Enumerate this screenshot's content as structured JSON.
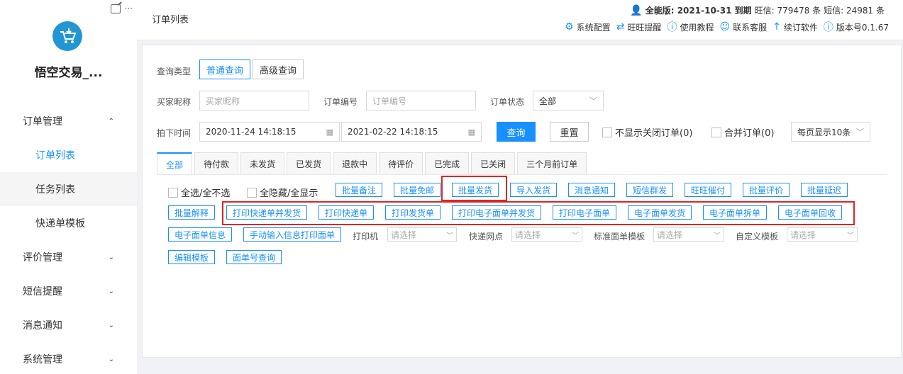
{
  "sidebar": {
    "app_name": "悟空交易_...",
    "menu": [
      {
        "label": "订单管理",
        "chev": "⌃"
      },
      {
        "label": "订单列表"
      },
      {
        "label": "任务列表"
      },
      {
        "label": "快递单模板"
      },
      {
        "label": "评价管理",
        "chev": "⌄"
      },
      {
        "label": "短信提醒",
        "chev": "⌄"
      },
      {
        "label": "消息通知",
        "chev": "⌄"
      },
      {
        "label": "系统管理",
        "chev": "⌄"
      }
    ]
  },
  "header": {
    "title": "订单列表",
    "edition": "全能版: 2021-10-31 到期",
    "wangxin": "旺信: 779478 条",
    "sms": "短信: 24981 条",
    "links": [
      "系统配置",
      "旺旺提醒",
      "使用教程",
      "联系客服",
      "续订软件",
      "版本号0.1.67"
    ]
  },
  "query": {
    "type_label": "查询类型",
    "normal": "普通查询",
    "advanced": "高级查询",
    "buyer_label": "买家昵称",
    "buyer_ph": "买家昵称",
    "order_no_label": "订单编号",
    "order_no_ph": "订单编号",
    "status_label": "订单状态",
    "status_value": "全部",
    "time_label": "拍下时间",
    "start_time": "2020-11-24 14:18:15",
    "end_time": "2021-02-22 14:18:15",
    "search": "查询",
    "reset": "重置",
    "hide_closed": "不显示关闭订单(0)",
    "merge": "合并订单(0)",
    "page_size": "每页显示10条"
  },
  "tabs": [
    "全部",
    "待付款",
    "未发货",
    "已发货",
    "退款中",
    "待评价",
    "已完成",
    "已关闭",
    "三个月前订单"
  ],
  "actions": {
    "select_all": "全选/全不选",
    "hide_all": "全隐藏/全显示",
    "row1": [
      "批量备注",
      "批量免邮",
      "批量发货",
      "导入发货",
      "消息通知",
      "短信群发",
      "旺旺催付",
      "批量评价",
      "批量延迟"
    ],
    "row2": [
      "批量解释",
      "打印快递单并发货",
      "打印快递单",
      "打印发货单",
      "打印电子面单并发货",
      "打印电子面单",
      "电子面单发货",
      "电子面单拆单",
      "电子面单回收"
    ],
    "row3_btns": [
      "电子面单信息",
      "手动输入信息打印面单"
    ],
    "printer_label": "打印机",
    "site_label": "快递网点",
    "template_label": "标准面单模板",
    "custom_label": "自定义模板",
    "select_ph": "请选择",
    "row4": [
      "编辑模板",
      "面单号查询"
    ]
  }
}
